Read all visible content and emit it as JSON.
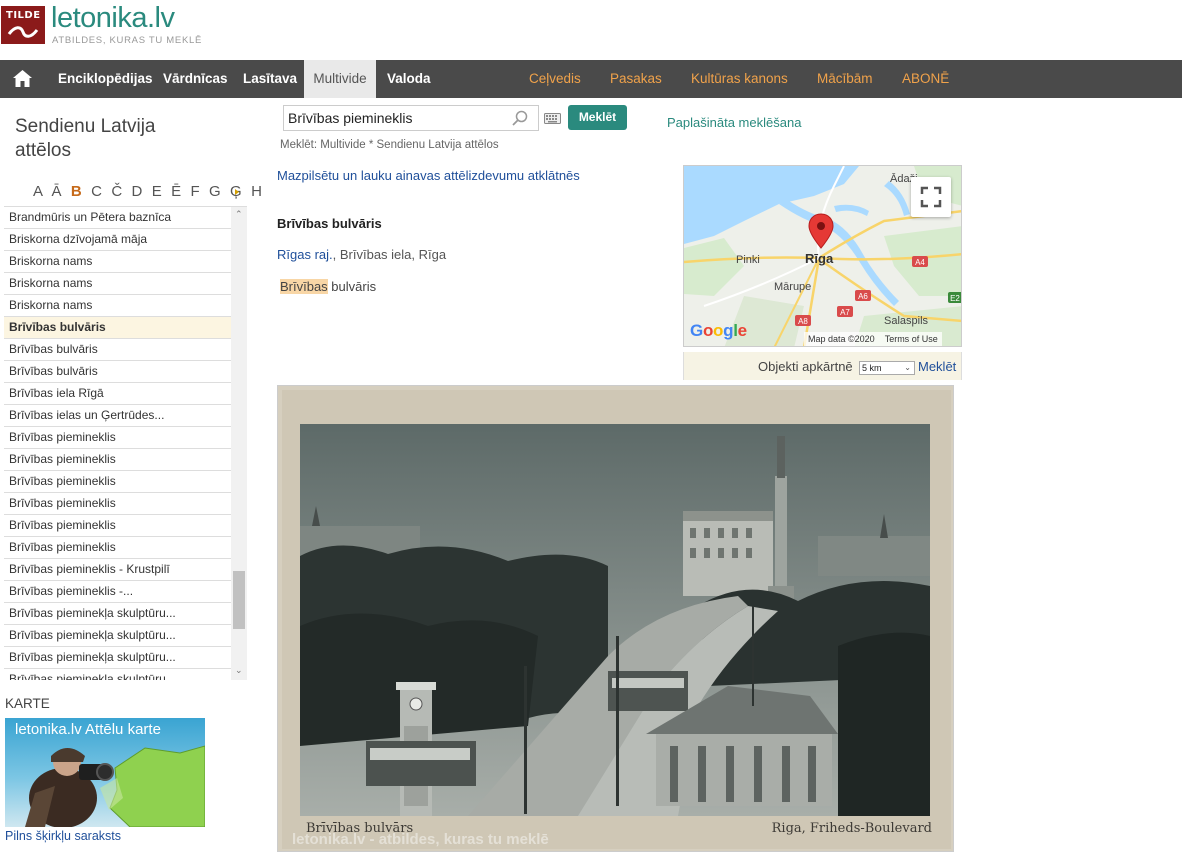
{
  "header": {
    "logo_text": "TILDE",
    "site_name": "letonika.lv",
    "tagline": "ATBILDES, KURAS TU MEKLĒ"
  },
  "nav": {
    "items": [
      {
        "label": "Enciklopēdijas"
      },
      {
        "label": "Vārdnīcas"
      },
      {
        "label": "Lasītava"
      },
      {
        "label": "Multivide"
      },
      {
        "label": "Valoda"
      },
      {
        "label": "Ceļvedis"
      },
      {
        "label": "Pasakas"
      },
      {
        "label": "Kultūras kanons"
      },
      {
        "label": "Mācībām"
      },
      {
        "label": "ABONĒ"
      }
    ]
  },
  "sidebar": {
    "title": "Sendienu Latvija attēlos",
    "alphabet_pre": "A Ā ",
    "alphabet_active": "B",
    "alphabet_post": " C Č D E Ē F G Ģ H",
    "items": [
      {
        "label": "Brandmūris un Pētera baznīca"
      },
      {
        "label": "Briskorna dzīvojamā māja"
      },
      {
        "label": "Briskorna nams"
      },
      {
        "label": "Briskorna nams"
      },
      {
        "label": "Briskorna nams"
      },
      {
        "label": "Brīvības bulvāris"
      },
      {
        "label": "Brīvības bulvāris"
      },
      {
        "label": "Brīvības bulvāris"
      },
      {
        "label": "Brīvības iela Rīgā"
      },
      {
        "label": "Brīvības ielas un Ģertrūdes..."
      },
      {
        "label": "Brīvības piemineklis"
      },
      {
        "label": "Brīvības piemineklis"
      },
      {
        "label": "Brīvības piemineklis"
      },
      {
        "label": "Brīvības piemineklis"
      },
      {
        "label": "Brīvības piemineklis"
      },
      {
        "label": "Brīvības piemineklis"
      },
      {
        "label": "Brīvības piemineklis - Krustpilī"
      },
      {
        "label": "Brīvības piemineklis -..."
      },
      {
        "label": "Brīvības pieminekļa skulptūru..."
      },
      {
        "label": "Brīvības pieminekļa skulptūru..."
      },
      {
        "label": "Brīvības pieminekļa skulptūru..."
      },
      {
        "label": "Brīvības pieminekļa skulptūru..."
      }
    ],
    "map_section_label": "KARTE",
    "map_banner_title": "letonika.lv Attēlu karte",
    "index_link": "Pilns šķirkļu saraksts"
  },
  "search": {
    "value": "Brīvības piemineklis",
    "button": "Meklēt",
    "advanced": "Paplašināta meklēšana",
    "scope": "Meklēt: Multivide * Sendienu Latvija attēlos"
  },
  "content": {
    "collection_link": "Mazpilsētu un lauku ainavas attēlizdevumu atklātnēs",
    "entry_title": "Brīvības bulvāris",
    "location_link": "Rīgas raj.",
    "location_rest": ", Brīvības iela, Rīga",
    "desc_highlight": "Brīvības",
    "desc_rest": " bulvāris"
  },
  "map": {
    "labels": {
      "city": "Rīga",
      "pinki": "Pinki",
      "marupe": "Mārupe",
      "salaspils": "Salaspils",
      "adazi": "Ādaži"
    },
    "road_labels": [
      "A4",
      "A6",
      "A7",
      "A8",
      "E2"
    ],
    "attribution": "Map data ©2020",
    "terms": "Terms of Use",
    "google": "Google"
  },
  "nearby": {
    "label": "Objekti apkārtnē",
    "selected": "5 km",
    "button": "Meklēt"
  },
  "photo": {
    "caption_left": "Brīvības bulvārs",
    "caption_right": "Riga, Friheds-Boulevard",
    "watermark": "letonika.lv - atbildes, kuras tu meklē"
  },
  "colors": {
    "brand_teal": "#2a8a7e",
    "nav_bg": "#4a4a4a",
    "nav_orange": "#f0a24a",
    "logo_red": "#8b1a1a",
    "highlight": "#f8d6a6"
  }
}
